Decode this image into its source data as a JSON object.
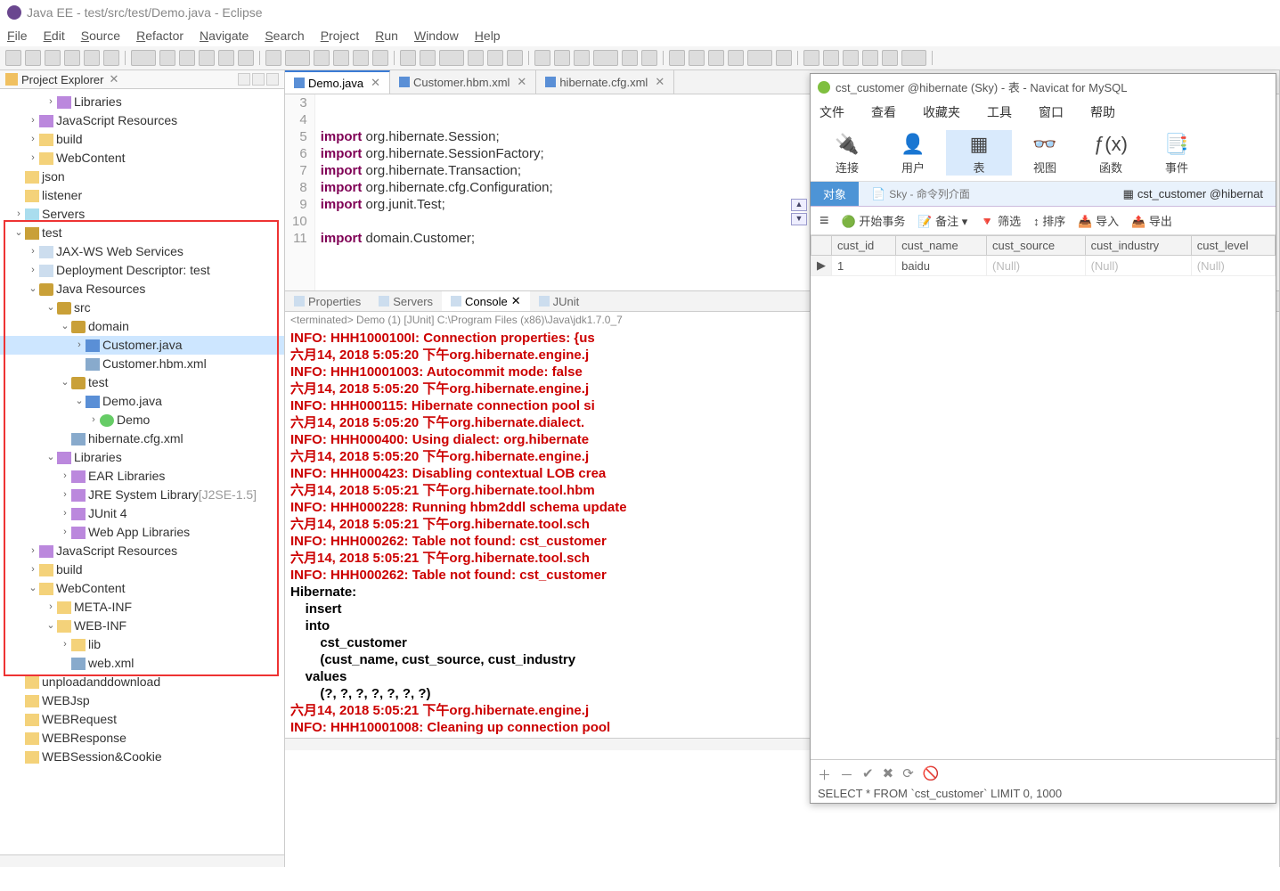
{
  "eclipse": {
    "title": "Java EE - test/src/test/Demo.java - Eclipse",
    "menus": [
      "File",
      "Edit",
      "Source",
      "Refactor",
      "Navigate",
      "Search",
      "Project",
      "Run",
      "Window",
      "Help"
    ],
    "project_explorer_label": "Project Explorer",
    "tree": [
      {
        "ind": 50,
        "tw": ">",
        "ic": "ic-lib",
        "label": "Libraries"
      },
      {
        "ind": 30,
        "tw": ">",
        "ic": "ic-lib",
        "label": "JavaScript Resources"
      },
      {
        "ind": 30,
        "tw": ">",
        "ic": "ic-fld",
        "label": "build"
      },
      {
        "ind": 30,
        "tw": ">",
        "ic": "ic-fld",
        "label": "WebContent"
      },
      {
        "ind": 14,
        "tw": "",
        "ic": "ic-fld",
        "label": "json"
      },
      {
        "ind": 14,
        "tw": "",
        "ic": "ic-fld",
        "label": "listener"
      },
      {
        "ind": 14,
        "tw": ">",
        "ic": "ic-srv",
        "label": "Servers"
      },
      {
        "ind": 14,
        "tw": "v",
        "ic": "ic-prj",
        "label": "test",
        "bold": true
      },
      {
        "ind": 30,
        "tw": ">",
        "ic": "ic-lnk",
        "label": "JAX-WS Web Services"
      },
      {
        "ind": 30,
        "tw": ">",
        "ic": "ic-lnk",
        "label": "Deployment Descriptor: test"
      },
      {
        "ind": 30,
        "tw": "v",
        "ic": "ic-pkg",
        "label": "Java Resources"
      },
      {
        "ind": 50,
        "tw": "v",
        "ic": "ic-pkg",
        "label": "src"
      },
      {
        "ind": 66,
        "tw": "v",
        "ic": "ic-pkg",
        "label": "domain"
      },
      {
        "ind": 82,
        "tw": ">",
        "ic": "ic-java",
        "label": "Customer.java",
        "sel": true
      },
      {
        "ind": 82,
        "tw": "",
        "ic": "ic-xml",
        "label": "Customer.hbm.xml"
      },
      {
        "ind": 66,
        "tw": "v",
        "ic": "ic-pkg",
        "label": "test"
      },
      {
        "ind": 82,
        "tw": "v",
        "ic": "ic-java",
        "label": "Demo.java"
      },
      {
        "ind": 98,
        "tw": ">",
        "ic": "ic-cls",
        "label": "Demo"
      },
      {
        "ind": 66,
        "tw": "",
        "ic": "ic-xml",
        "label": "hibernate.cfg.xml"
      },
      {
        "ind": 50,
        "tw": "v",
        "ic": "ic-lib",
        "label": "Libraries"
      },
      {
        "ind": 66,
        "tw": ">",
        "ic": "ic-lib",
        "label": "EAR Libraries"
      },
      {
        "ind": 66,
        "tw": ">",
        "ic": "ic-lib",
        "label": "JRE System Library",
        "suffix": "[J2SE-1.5]"
      },
      {
        "ind": 66,
        "tw": ">",
        "ic": "ic-lib",
        "label": "JUnit 4"
      },
      {
        "ind": 66,
        "tw": ">",
        "ic": "ic-lib",
        "label": "Web App Libraries"
      },
      {
        "ind": 30,
        "tw": ">",
        "ic": "ic-lib",
        "label": "JavaScript Resources"
      },
      {
        "ind": 30,
        "tw": ">",
        "ic": "ic-fld",
        "label": "build"
      },
      {
        "ind": 30,
        "tw": "v",
        "ic": "ic-fld-o",
        "label": "WebContent"
      },
      {
        "ind": 50,
        "tw": ">",
        "ic": "ic-fld-o",
        "label": "META-INF"
      },
      {
        "ind": 50,
        "tw": "v",
        "ic": "ic-fld-o",
        "label": "WEB-INF"
      },
      {
        "ind": 66,
        "tw": ">",
        "ic": "ic-fld-o",
        "label": "lib"
      },
      {
        "ind": 66,
        "tw": "",
        "ic": "ic-xml",
        "label": "web.xml"
      },
      {
        "ind": 14,
        "tw": "",
        "ic": "ic-fld",
        "label": "unploadanddownload"
      },
      {
        "ind": 14,
        "tw": "",
        "ic": "ic-fld",
        "label": "WEBJsp"
      },
      {
        "ind": 14,
        "tw": "",
        "ic": "ic-fld",
        "label": "WEBRequest"
      },
      {
        "ind": 14,
        "tw": "",
        "ic": "ic-fld",
        "label": "WEBResponse"
      },
      {
        "ind": 14,
        "tw": "",
        "ic": "ic-fld",
        "label": "WEBSession&Cookie"
      }
    ],
    "editor_tabs": [
      {
        "label": "Demo.java",
        "active": true
      },
      {
        "label": "Customer.hbm.xml"
      },
      {
        "label": "hibernate.cfg.xml"
      }
    ],
    "code_lines": [
      {
        "n": 3,
        "text": ""
      },
      {
        "n": 4,
        "text": ""
      },
      {
        "n": 5,
        "kw": "import",
        "rest": " org.hibernate.Session;"
      },
      {
        "n": 6,
        "kw": "import",
        "rest": " org.hibernate.SessionFactory;"
      },
      {
        "n": 7,
        "kw": "import",
        "rest": " org.hibernate.Transaction;"
      },
      {
        "n": 8,
        "kw": "import",
        "rest": " org.hibernate.cfg.Configuration;"
      },
      {
        "n": 9,
        "kw": "import",
        "rest": " org.junit.Test;"
      },
      {
        "n": 10,
        "text": ""
      },
      {
        "n": 11,
        "kw": "import",
        "rest": " domain.Customer;"
      }
    ],
    "console_tabs": [
      "Properties",
      "Servers",
      "Console",
      "JUnit"
    ],
    "console_active": 2,
    "console_header": "<terminated> Demo (1) [JUnit] C:\\Program Files (x86)\\Java\\jdk1.7.0_7",
    "console_lines": [
      {
        "cls": "red",
        "t": "INFO: HHH1000100I: Connection properties: {us"
      },
      {
        "cls": "red",
        "t": "六月14, 2018 5:05:20 下午org.hibernate.engine.j"
      },
      {
        "cls": "red",
        "t": "INFO: HHH10001003: Autocommit mode: false"
      },
      {
        "cls": "red",
        "t": "六月14, 2018 5:05:20 下午org.hibernate.engine.j"
      },
      {
        "cls": "red",
        "t": "INFO: HHH000115: Hibernate connection pool si"
      },
      {
        "cls": "red",
        "t": "六月14, 2018 5:05:20 下午org.hibernate.dialect."
      },
      {
        "cls": "red",
        "t": "INFO: HHH000400: Using dialect: org.hibernate"
      },
      {
        "cls": "red",
        "t": "六月14, 2018 5:05:20 下午org.hibernate.engine.j"
      },
      {
        "cls": "red",
        "t": "INFO: HHH000423: Disabling contextual LOB crea"
      },
      {
        "cls": "red",
        "t": "六月14, 2018 5:05:21 下午org.hibernate.tool.hbm"
      },
      {
        "cls": "red",
        "t": "INFO: HHH000228: Running hbm2ddl schema update"
      },
      {
        "cls": "red",
        "t": "六月14, 2018 5:05:21 下午org.hibernate.tool.sch"
      },
      {
        "cls": "red",
        "t": "INFO: HHH000262: Table not found: cst_customer"
      },
      {
        "cls": "red",
        "t": "六月14, 2018 5:05:21 下午org.hibernate.tool.sch"
      },
      {
        "cls": "red",
        "t": "INFO: HHH000262: Table not found: cst_customer"
      },
      {
        "cls": "black",
        "t": "Hibernate: "
      },
      {
        "cls": "black",
        "t": "    insert "
      },
      {
        "cls": "black",
        "t": "    into"
      },
      {
        "cls": "black",
        "t": "        cst_customer"
      },
      {
        "cls": "black",
        "t": "        (cust_name, cust_source, cust_industry"
      },
      {
        "cls": "black",
        "t": "    values"
      },
      {
        "cls": "black",
        "t": "        (?, ?, ?, ?, ?, ?, ?)"
      },
      {
        "cls": "red",
        "t": "六月14, 2018 5:05:21 下午org.hibernate.engine.j"
      },
      {
        "cls": "red",
        "t": "INFO: HHH10001008: Cleaning up connection pool"
      }
    ]
  },
  "navicat": {
    "title": "cst_customer @hibernate (Sky) - 表 - Navicat for MySQL",
    "menus": [
      "文件",
      "查看",
      "收藏夹",
      "工具",
      "窗口",
      "帮助"
    ],
    "toolbar": [
      {
        "glyph": "🔌",
        "label": "连接"
      },
      {
        "glyph": "👤",
        "label": "用户"
      },
      {
        "glyph": "▦",
        "label": "表",
        "active": true
      },
      {
        "glyph": "👓",
        "label": "视图"
      },
      {
        "glyph": "ƒ(x)",
        "label": "函数"
      },
      {
        "glyph": "📑",
        "label": "事件"
      }
    ],
    "subtabs": {
      "obj": "对象",
      "sky": "Sky - 命令列介面",
      "cst": "cst_customer @hibernat"
    },
    "actions": {
      "begin": "开始事务",
      "note": "备注",
      "filter": "筛选",
      "sort": "排序",
      "import": "导入",
      "export": "导出"
    },
    "columns": [
      "cust_id",
      "cust_name",
      "cust_source",
      "cust_industry",
      "cust_level"
    ],
    "rows": [
      {
        "cust_id": "1",
        "cust_name": "baidu",
        "cust_source": "(Null)",
        "cust_industry": "(Null)",
        "cust_level": "(Null)"
      }
    ],
    "status_sql": "SELECT * FROM `cst_customer` LIMIT 0, 1000"
  }
}
